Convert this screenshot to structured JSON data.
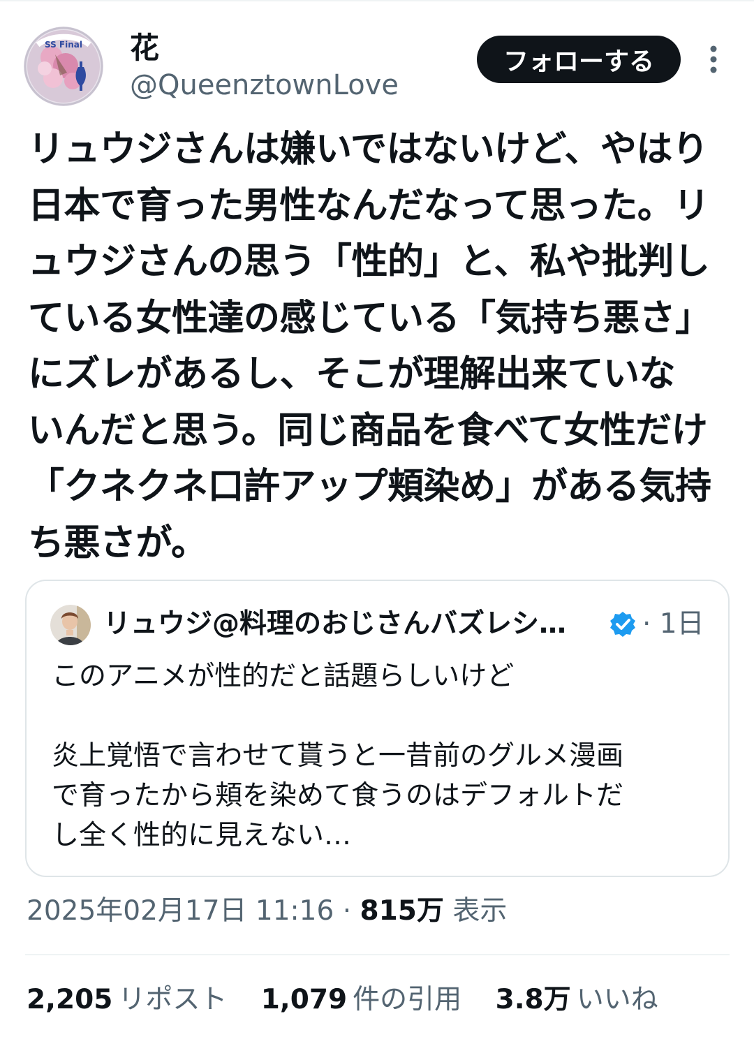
{
  "author": {
    "display_name": "花",
    "handle": "@QueenztownLove",
    "avatar_icon": "profile-avatar-icon",
    "avatar_text": "SS Final"
  },
  "follow_label": "フォローする",
  "more_icon": "more-vertical-icon",
  "post_text": "リュウジさんは嫌いではないけど、やはり\n日本で育った男性なんだなって思った。リ\nュウジさんの思う「性的」と、私や批判し\nている女性達の感じている「気持ち悪さ」\nにズレがあるし、そこが理解出来ていな\nいんだと思う。同じ商品を食べて女性だけ\n「クネクネ口許アップ頬染め」がある気持\nち悪さが。",
  "quoted": {
    "avatar_icon": "quoted-user-avatar-icon",
    "name": "リュウジ@料理のおじさんバズレシ…",
    "verified_icon": "verified-badge-icon",
    "time": "· 1日",
    "text": "このアニメが性的だと話題らしいけど\n\n炎上覚悟で言わせて貰うと一昔前のグルメ漫画\nで育ったから頬を染めて食うのはデフォルトだ\nし全く性的に見えない…"
  },
  "meta": {
    "datetime": "2025年02月17日 11:16",
    "separator": " · ",
    "views": "815万",
    "views_label": "表示"
  },
  "stats": [
    {
      "number": "2,205",
      "label": "リポスト"
    },
    {
      "number": "1,079",
      "label": "件の引用"
    },
    {
      "number": "3.8万",
      "label": "いいね"
    }
  ],
  "colors": {
    "text": "#0f1419",
    "secondary": "#536471",
    "verified": "#1d9bf0",
    "button_bg": "#0f1419"
  }
}
